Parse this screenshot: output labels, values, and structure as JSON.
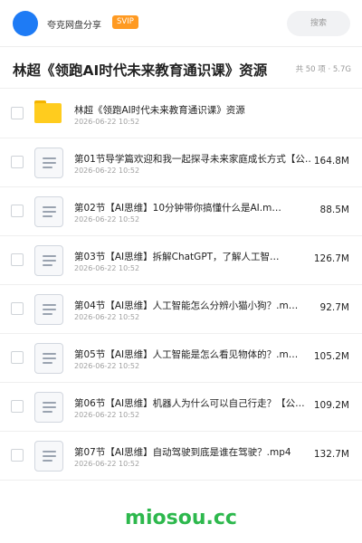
{
  "header": {
    "username": "夸克网盘分享",
    "badge": "SVIP",
    "search_placeholder": "搜索",
    "brand_color": "#1e7bf5",
    "badge_color": "#ff9a22"
  },
  "folder": {
    "title": "林超《领跑AI时代未来教育通识课》资源",
    "meta": "共 50 项 · 5.7G"
  },
  "files": [
    {
      "name": "林超《领跑AI时代未来教育通识课》资源",
      "date": "2026-06-22 10:52",
      "size": "",
      "icon": "folder-icon"
    },
    {
      "name": "第01节导学篇欢迎和我一起探寻未来家庭成长方式【公…",
      "date": "2026-06-22 10:52",
      "size": "164.8M",
      "icon": "document-icon"
    },
    {
      "name": "第02节【AI思维】10分钟带你搞懂什么是AI.m…",
      "date": "2026-06-22 10:52",
      "size": "88.5M",
      "icon": "document-icon"
    },
    {
      "name": "第03节【AI思维】拆解ChatGPT，了解人工智…",
      "date": "2026-06-22 10:52",
      "size": "126.7M",
      "icon": "document-icon"
    },
    {
      "name": "第04节【AI思维】人工智能怎么分辨小猫小狗？.m…",
      "date": "2026-06-22 10:52",
      "size": "92.7M",
      "icon": "document-icon"
    },
    {
      "name": "第05节【AI思维】人工智能是怎么看见物体的？.m…",
      "date": "2026-06-22 10:52",
      "size": "105.2M",
      "icon": "document-icon"
    },
    {
      "name": "第06节【AI思维】机器人为什么可以自己行走？【公…",
      "date": "2026-06-22 10:52",
      "size": "109.2M",
      "icon": "document-icon"
    },
    {
      "name": "第07节【AI思维】自动驾驶到底是谁在驾驶？.mp4",
      "date": "2026-06-22 10:52",
      "size": "132.7M",
      "icon": "document-icon"
    }
  ],
  "watermark": {
    "text": "miosou.cc",
    "color": "#2db84d"
  }
}
